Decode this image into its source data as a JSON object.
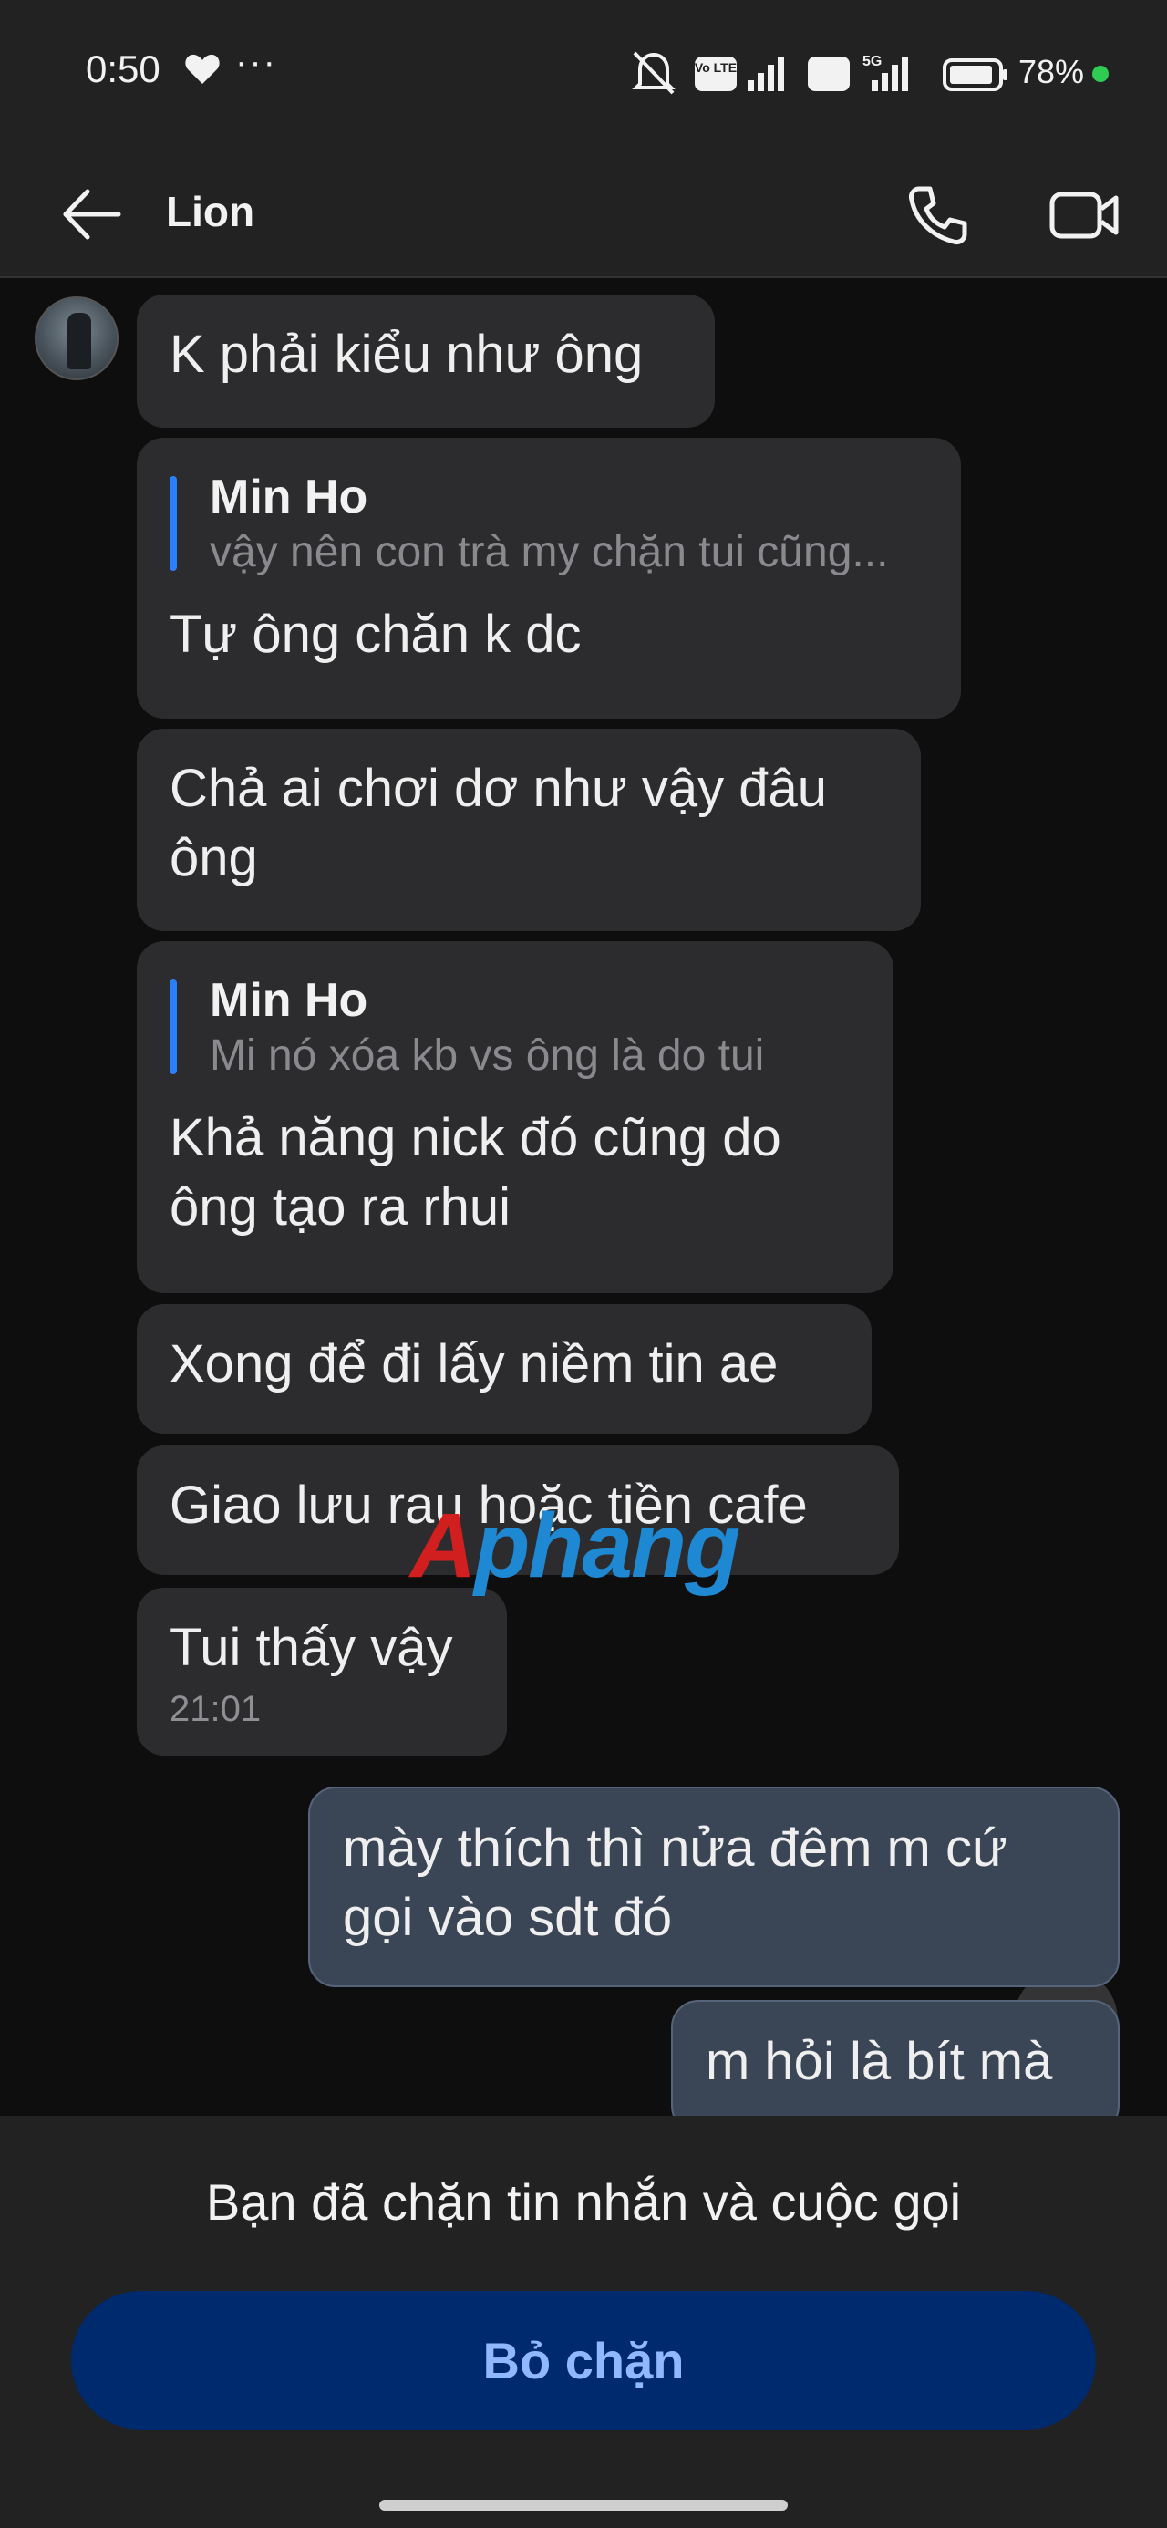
{
  "status_bar": {
    "time": "0:50",
    "dots": "···",
    "network_labels": [
      "Vo LTE",
      "Vo LTE",
      "5G"
    ],
    "battery_percent": "78%",
    "icons": [
      "heart-icon",
      "mute-icon",
      "volte-icon",
      "signal-icon",
      "5g-icon",
      "battery-icon"
    ]
  },
  "header": {
    "contact_name": "Lion",
    "icons": [
      "back-arrow-icon",
      "phone-icon",
      "video-call-icon"
    ]
  },
  "messages": [
    {
      "direction": "in",
      "text": "K phải kiểu như ông"
    },
    {
      "direction": "in",
      "reply_to": {
        "name": "Min Ho",
        "text": "vậy nên con trà my chặn tui cũng..."
      },
      "text": "Tự ông chăn k dc"
    },
    {
      "direction": "in",
      "lines": [
        "Chả ai chơi dơ như vậy đâu",
        "ông"
      ]
    },
    {
      "direction": "in",
      "reply_to": {
        "name": "Min Ho",
        "text": "Mi nó xóa kb vs ông là do tui"
      },
      "lines": [
        "Khả năng nick đó cũng do",
        "ông tạo ra rhui"
      ]
    },
    {
      "direction": "in",
      "text": "Xong để đi lấy niềm tin ae"
    },
    {
      "direction": "in",
      "text": "Giao lưu rau hoặc tiền cafe"
    },
    {
      "direction": "in",
      "text": "Tui thấy vậy",
      "time": "21:01"
    },
    {
      "direction": "out",
      "lines": [
        "mày thích thì nửa đêm m cứ",
        "gọi vào sdt đó"
      ]
    },
    {
      "direction": "out",
      "text": "m hỏi là bít mà"
    }
  ],
  "watermark": {
    "prefix": "A",
    "rest": "phang"
  },
  "scroll_down_icon": "double-chevron-down-icon",
  "blocked_notice": "Bạn đã chặn tin nhắn và cuộc gọi",
  "unblock_label": "Bỏ chặn",
  "colors": {
    "background": "#0e0e0e",
    "incoming_bubble": "#2c2c2e",
    "outgoing_bubble": "#3a4556",
    "reply_accent": "#2a7fff",
    "unblock_button": "#002a6e",
    "unblock_text": "#8fb8ff"
  }
}
